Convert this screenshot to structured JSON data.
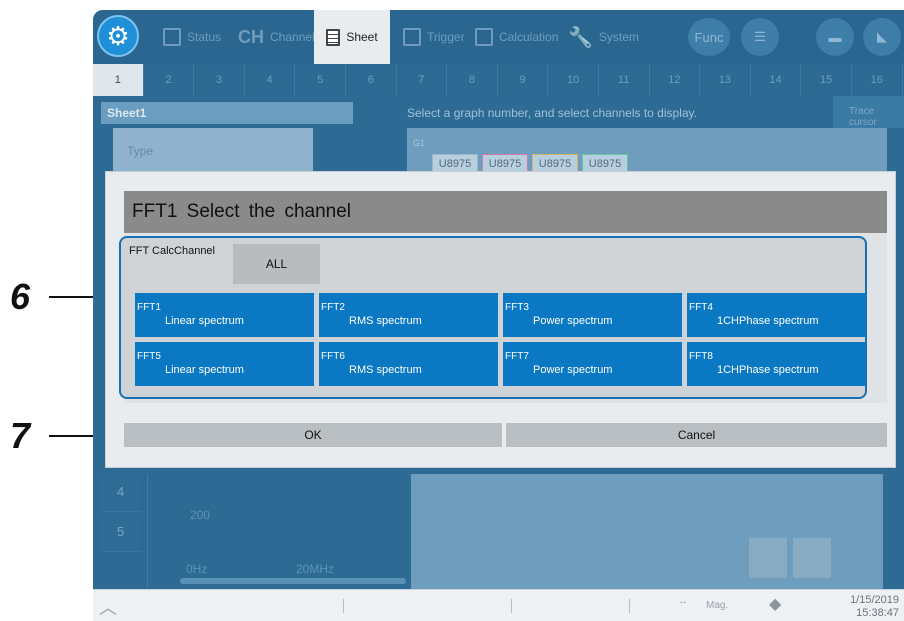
{
  "callouts": {
    "six": "6",
    "seven": "7"
  },
  "toolbar": {
    "status": "Status",
    "ch_prefix": "CH",
    "channel": "Channel",
    "sheet": "Sheet",
    "trigger": "Trigger",
    "calculation": "Calculation",
    "system": "System",
    "func": "Func"
  },
  "sheet_tabs": [
    "1",
    "2",
    "3",
    "4",
    "5",
    "6",
    "7",
    "8",
    "9",
    "10",
    "11",
    "12",
    "13",
    "14",
    "15",
    "16"
  ],
  "sheet": {
    "title": "Sheet1",
    "message": "Select a graph number, and select channels to display.",
    "trace_cursor": "Trace cursor",
    "type_label": "Type",
    "graph_label": "G1",
    "chips": [
      "U8975",
      "U8975",
      "U8975",
      "U8975"
    ],
    "rows": [
      "4",
      "5"
    ],
    "graph_value": "200",
    "x_start": "0Hz",
    "x_mid": "20MHz"
  },
  "dialog": {
    "title": "FFT1   Select the channel",
    "group_label": "FFT CalcChannel",
    "all": "ALL",
    "channels": [
      {
        "num": "FFT1",
        "desc": "Linear spectrum"
      },
      {
        "num": "FFT2",
        "desc": "RMS spectrum"
      },
      {
        "num": "FFT3",
        "desc": "Power spectrum"
      },
      {
        "num": "FFT4",
        "desc": "1CHPhase spectrum"
      },
      {
        "num": "FFT5",
        "desc": "Linear spectrum"
      },
      {
        "num": "FFT6",
        "desc": "RMS spectrum"
      },
      {
        "num": "FFT7",
        "desc": "Power spectrum"
      },
      {
        "num": "FFT8",
        "desc": "1CHPhase spectrum"
      }
    ],
    "ok": "OK",
    "cancel": "Cancel"
  },
  "statusbar": {
    "mag": "Mag.",
    "date": "1/15/2019",
    "time": "15:38:47"
  },
  "colors": {
    "accent": "#0a78c2",
    "highlight_border": "#1a6fb0"
  }
}
